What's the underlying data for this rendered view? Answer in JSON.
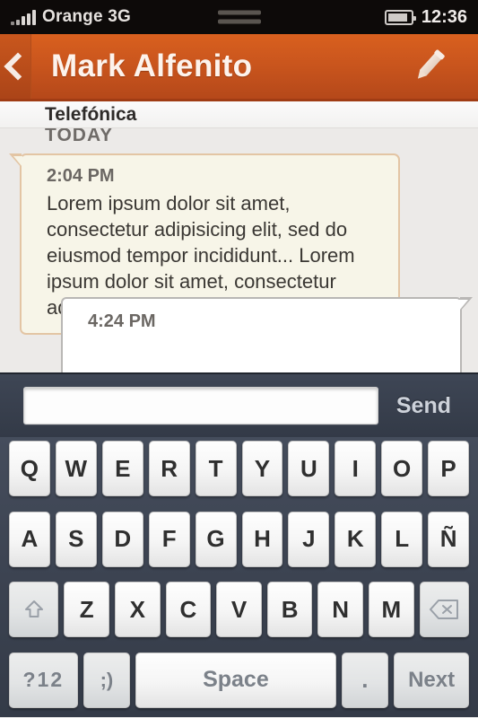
{
  "statusbar": {
    "carrier": "Orange 3G",
    "clock": "12:36",
    "signal_icon": "signal-bars-icon",
    "battery_icon": "battery-icon",
    "handle_icon": "drag-handle-icon"
  },
  "header": {
    "title": "Mark Alfenito",
    "back_icon": "back-chevron-icon",
    "edit_icon": "pencil-icon",
    "accent_color": "#c9551d"
  },
  "conversation": {
    "contact_label": "Telefónica",
    "day_separator": "TODAY",
    "messages": [
      {
        "time": "2:04 PM",
        "text": "Lorem ipsum dolor sit amet, consectetur adipisicing elit, sed do eiusmod tempor incididunt... Lorem ipsum dolor sit amet, consectetur adipisi-",
        "direction": "incoming",
        "bubble_color": "#f7f5e8",
        "border_color": "#e3c5a4"
      },
      {
        "time": "4:24 PM",
        "text": "",
        "direction": "outgoing",
        "bubble_color": "#ffffff",
        "border_color": "#b9b7b5"
      }
    ]
  },
  "input_bar": {
    "message_value": "",
    "message_placeholder": "",
    "send_label": "Send",
    "background_color": "#3a4250"
  },
  "keyboard": {
    "row1": [
      "Q",
      "W",
      "E",
      "R",
      "T",
      "Y",
      "U",
      "I",
      "O",
      "P"
    ],
    "row2": [
      "A",
      "S",
      "D",
      "F",
      "G",
      "H",
      "J",
      "K",
      "L",
      "Ñ"
    ],
    "row3_letters": [
      "Z",
      "X",
      "C",
      "V",
      "B",
      "N",
      "M"
    ],
    "shift_icon": "shift-arrow-icon",
    "backspace_icon": "backspace-icon",
    "symbols_label": "?12",
    "emoji_label": ";)",
    "space_label": "Space",
    "period_label": ".",
    "next_label": "Next"
  }
}
